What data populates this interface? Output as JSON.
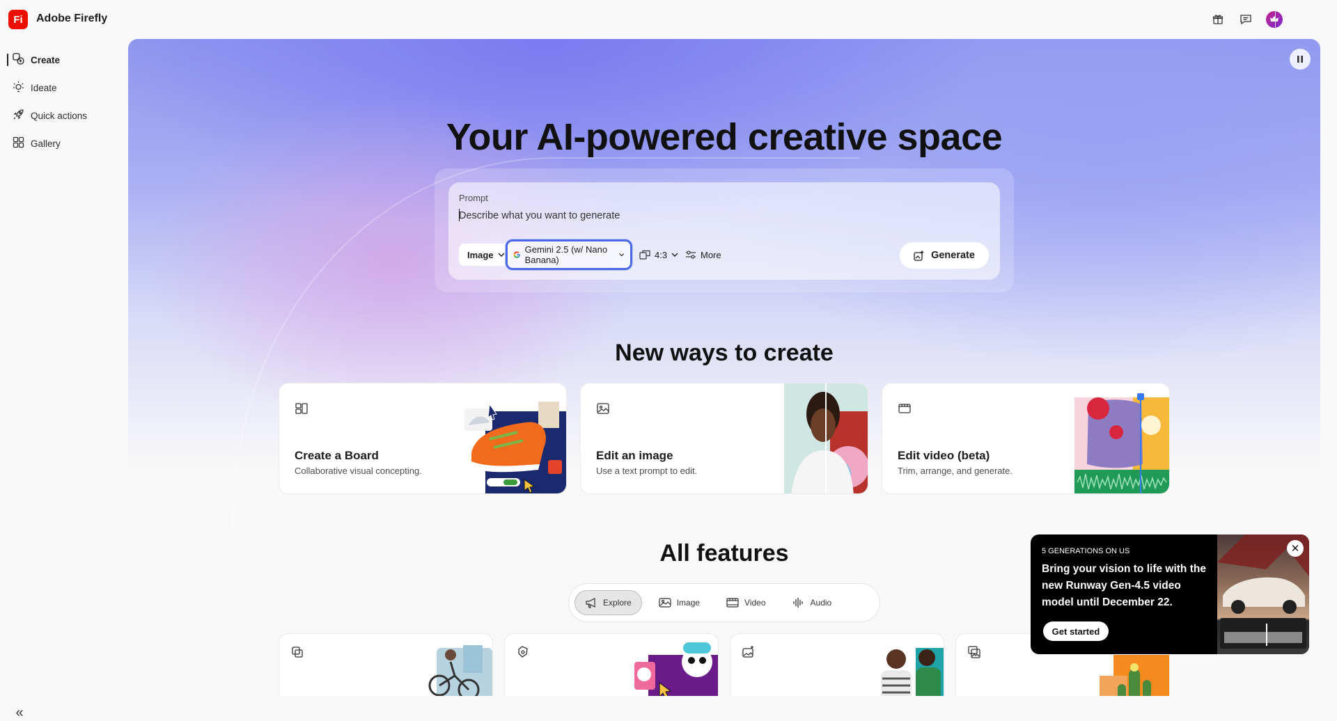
{
  "app": {
    "logo_text": "Fi",
    "title": "Adobe Firefly"
  },
  "sidebar": {
    "items": [
      {
        "label": "Create",
        "icon": "create-icon",
        "active": true
      },
      {
        "label": "Ideate",
        "icon": "ideate-icon",
        "active": false
      },
      {
        "label": "Quick actions",
        "icon": "rocket-icon",
        "active": false
      },
      {
        "label": "Gallery",
        "icon": "gallery-icon",
        "active": false
      }
    ],
    "collapse_icon": "«"
  },
  "header_icons": [
    "gift-icon",
    "chat-icon",
    "avatar-crown-icon"
  ],
  "hero": {
    "title": "Your AI-powered creative space",
    "prompt": {
      "label": "Prompt",
      "placeholder": "Describe what you want to generate",
      "value": ""
    },
    "controls": {
      "type": "Image",
      "model": "Gemini 2.5 (w/ Nano Banana)",
      "ratio": "4:3",
      "more": "More",
      "generate": "Generate"
    }
  },
  "new_ways": {
    "title": "New ways to create",
    "cards": [
      {
        "title": "Create a Board",
        "subtitle": "Collaborative visual concepting."
      },
      {
        "title": "Edit an image",
        "subtitle": "Use a text prompt to edit."
      },
      {
        "title": "Edit video (beta)",
        "subtitle": "Trim, arrange, and generate."
      }
    ]
  },
  "all_features": {
    "title": "All features",
    "tabs": [
      {
        "label": "Explore",
        "active": true
      },
      {
        "label": "Image",
        "active": false
      },
      {
        "label": "Video",
        "active": false
      },
      {
        "label": "Audio",
        "active": false
      }
    ]
  },
  "promo": {
    "eyebrow": "5 GENERATIONS ON US",
    "text": "Bring your vision to life with the new Runway Gen-4.5 video model until December 22.",
    "button": "Get started",
    "close": "✕"
  },
  "colors": {
    "brand": "#eb1000",
    "focus_ring": "#4b68e8"
  }
}
